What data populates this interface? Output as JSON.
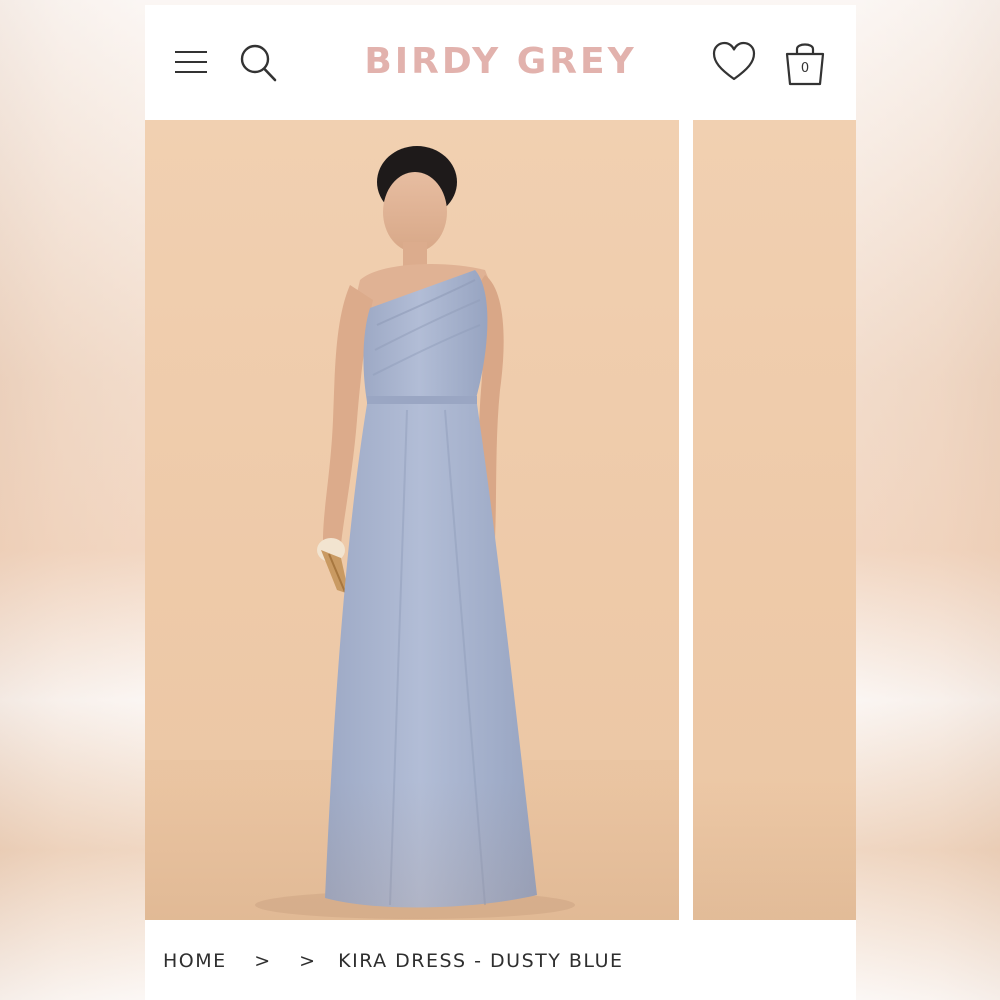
{
  "header": {
    "brand": "BIRDY GREY",
    "cart_count": "0"
  },
  "icons": [
    "menu-icon",
    "search-icon",
    "heart-icon",
    "bag-icon"
  ],
  "colors": {
    "brand_pink": "#e2b2ad",
    "backdrop": "#f1d0b1",
    "dress_dusty_blue": "#a9b5cf"
  },
  "carousel": {
    "slides": [
      "main-product-photo",
      "next-product-photo"
    ]
  },
  "breadcrumb": {
    "home": "HOME",
    "sep1": ">",
    "sep2": ">",
    "current": "KIRA DRESS - DUSTY BLUE"
  }
}
